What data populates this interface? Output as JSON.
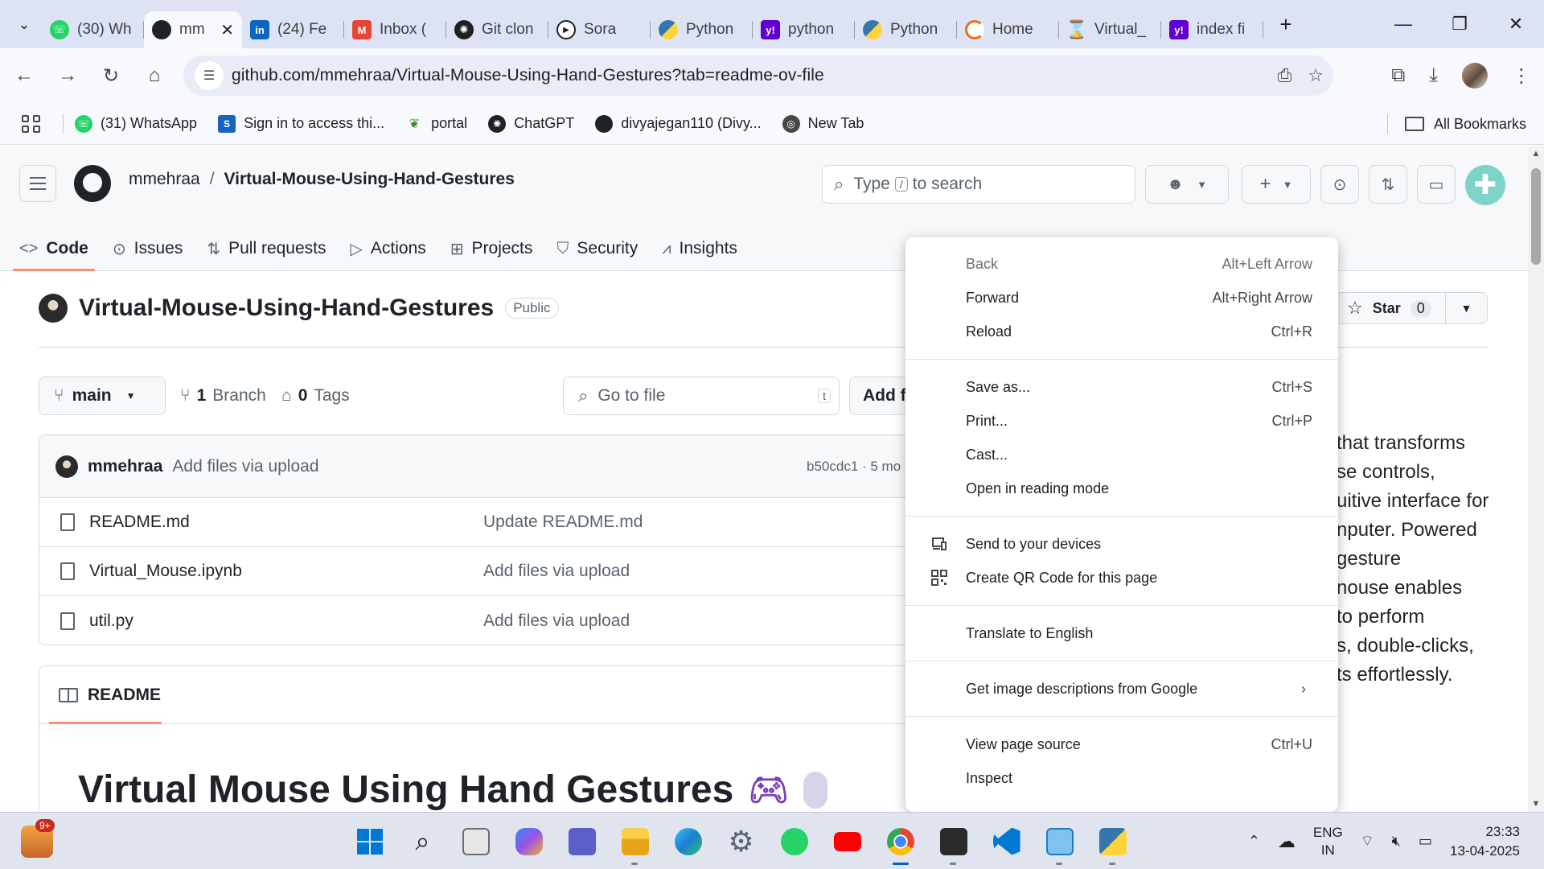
{
  "browser": {
    "tabs": [
      {
        "label": "(30) Wh",
        "icon": "whatsapp-icon",
        "color": "#25d366"
      },
      {
        "label": "mm",
        "icon": "github-icon",
        "color": "#1f2328",
        "active": true
      },
      {
        "label": "(24) Fe",
        "icon": "linkedin-icon",
        "color": "#0a66c2"
      },
      {
        "label": "Inbox (",
        "icon": "gmail-icon",
        "color": "#ea4335"
      },
      {
        "label": "Git clon",
        "icon": "chatgpt-icon",
        "color": "#202123"
      },
      {
        "label": "Sora",
        "icon": "sora-icon",
        "color": "#202123"
      },
      {
        "label": "Python",
        "icon": "python-icon",
        "color": "#3776ab"
      },
      {
        "label": "python",
        "icon": "yahoo-icon",
        "color": "#6001d2"
      },
      {
        "label": "Python",
        "icon": "python-icon",
        "color": "#3776ab"
      },
      {
        "label": "Home",
        "icon": "home-ring-icon",
        "color": "#e8711c"
      },
      {
        "label": "Virtual_",
        "icon": "hourglass-icon",
        "color": "#e8711c"
      },
      {
        "label": "index fi",
        "icon": "yahoo-icon",
        "color": "#6001d2"
      }
    ],
    "url": "github.com/mmehraa/Virtual-Mouse-Using-Hand-Gestures?tab=readme-ov-file",
    "bookmarks": [
      {
        "label": "(31) WhatsApp",
        "icon": "whatsapp-icon",
        "color": "#25d366"
      },
      {
        "label": "Sign in to access thi...",
        "icon": "s-logo-icon",
        "color": "#1565c0"
      },
      {
        "label": "portal",
        "icon": "leaf-icon",
        "color": "#3a8a2c"
      },
      {
        "label": "ChatGPT",
        "icon": "chatgpt-icon",
        "color": "#202123"
      },
      {
        "label": "divyajegan110 (Divy...",
        "icon": "github-icon",
        "color": "#1f2328"
      },
      {
        "label": "New Tab",
        "icon": "globe-icon",
        "color": "#474747"
      }
    ],
    "all_bookmarks": "All Bookmarks"
  },
  "github": {
    "owner": "mmehraa",
    "repo": "Virtual-Mouse-Using-Hand-Gestures",
    "search_placeholder_pre": "Type",
    "search_key": "/",
    "search_placeholder_post": "to search",
    "nav": [
      {
        "label": "Code",
        "icon": "code-icon",
        "active": true
      },
      {
        "label": "Issues",
        "icon": "issue-icon"
      },
      {
        "label": "Pull requests",
        "icon": "pull-request-icon"
      },
      {
        "label": "Actions",
        "icon": "play-icon"
      },
      {
        "label": "Projects",
        "icon": "table-icon"
      },
      {
        "label": "Security",
        "icon": "shield-icon"
      },
      {
        "label": "Insights",
        "icon": "graph-icon"
      }
    ],
    "repo_title": "Virtual-Mouse-Using-Hand-Gestures",
    "visibility": "Public",
    "star_label": "Star",
    "star_count": "0",
    "branch": "main",
    "branch_count": "1",
    "branch_label": "Branch",
    "tag_count": "0",
    "tag_label": "Tags",
    "goto_placeholder": "Go to file",
    "goto_key": "t",
    "add_file": "Add f",
    "latest_commit": {
      "author": "mmehraa",
      "message": "Add files via upload",
      "hash": "b50cdc1 · 5 mo"
    },
    "files": [
      {
        "name": "README.md",
        "commit": "Update README.md"
      },
      {
        "name": "Virtual_Mouse.ipynb",
        "commit": "Add files via upload"
      },
      {
        "name": "util.py",
        "commit": "Add files via upload"
      }
    ],
    "readme_tab": "README",
    "readme_title": "Virtual Mouse Using Hand Gestures",
    "about_lines": [
      "that transforms",
      "se controls,",
      "uitive interface for",
      "nputer. Powered",
      "gesture",
      "nouse enables",
      "to perform",
      "s, double-clicks,",
      "ts effortlessly."
    ]
  },
  "context_menu": {
    "items": [
      {
        "label": "Back",
        "shortcut": "Alt+Left Arrow",
        "disabled": true
      },
      {
        "label": "Forward",
        "shortcut": "Alt+Right Arrow"
      },
      {
        "label": "Reload",
        "shortcut": "Ctrl+R"
      },
      {
        "label": "Save as...",
        "shortcut": "Ctrl+S"
      },
      {
        "label": "Print...",
        "shortcut": "Ctrl+P"
      },
      {
        "label": "Cast..."
      },
      {
        "label": "Open in reading mode"
      },
      {
        "label": "Send to your devices",
        "icon": "devices-icon"
      },
      {
        "label": "Create QR Code for this page",
        "icon": "qr-code-icon"
      },
      {
        "label": "Translate to English"
      },
      {
        "label": "Get image descriptions from Google"
      },
      {
        "label": "View page source",
        "shortcut": "Ctrl+U"
      },
      {
        "label": "Inspect"
      }
    ]
  },
  "taskbar": {
    "widget_badge": "9+",
    "lang_top": "ENG",
    "lang_bottom": "IN",
    "time": "23:33",
    "date": "13-04-2025"
  }
}
